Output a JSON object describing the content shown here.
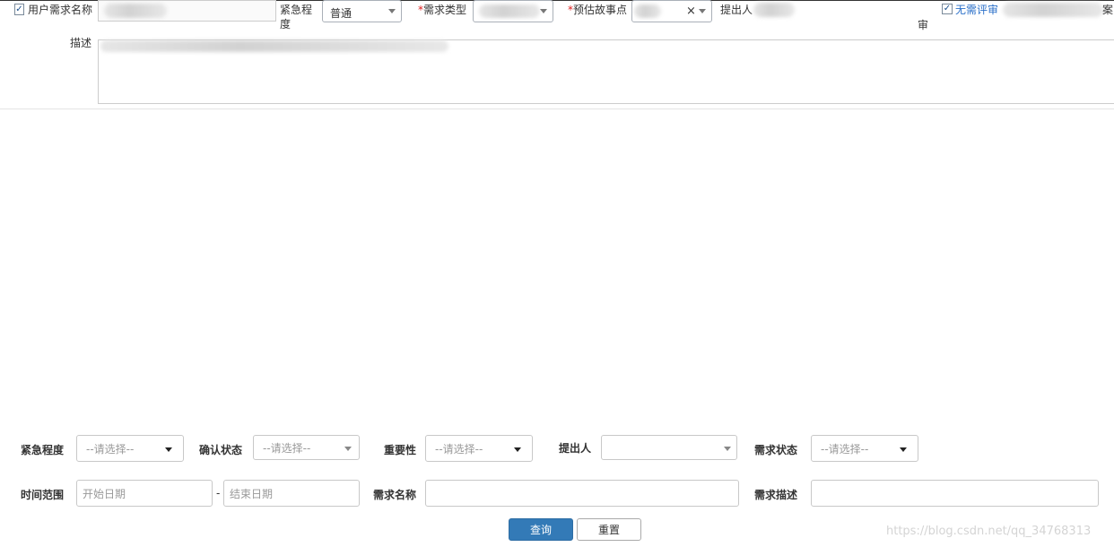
{
  "top_form": {
    "name_label": "用户需求名称",
    "urgency_label_line1": "紧急程",
    "urgency_label_line2": "度",
    "urgency_value": "普通",
    "type_required_mark": "*",
    "type_label": "需求类型",
    "story_points_required_mark": "*",
    "story_points_label": "预估故事点",
    "story_points_clear": "×",
    "proposer_label": "提出人",
    "no_review_label": "无需评审",
    "no_review_wrap": "审",
    "case_fragment": "案",
    "desc_label": "描述"
  },
  "filter": {
    "urgency_label": "紧急程度",
    "urgency_placeholder": "--请选择--",
    "confirm_label": "确认状态",
    "confirm_placeholder": "--请选择--",
    "importance_label": "重要性",
    "importance_placeholder": "--请选择--",
    "proposer_label": "提出人",
    "proposer_value": "",
    "status_label": "需求状态",
    "status_placeholder": "--请选择--",
    "time_label": "时间范围",
    "start_placeholder": "开始日期",
    "date_sep": "-",
    "end_placeholder": "结束日期",
    "name_label": "需求名称",
    "desc_label": "需求描述",
    "query_button": "查询",
    "reset_button": "重置"
  },
  "watermark": "https://blog.csdn.net/qq_34768313",
  "colors": {
    "primary": "#337ab7",
    "link": "#2a6fc9",
    "required": "#e02020"
  }
}
